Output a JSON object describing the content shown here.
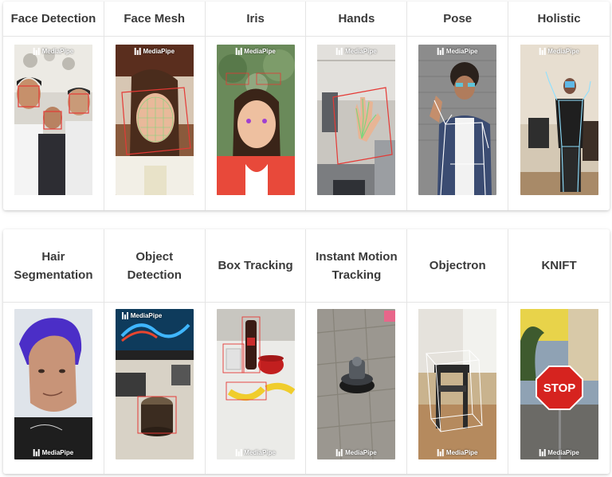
{
  "brand": "MediaPipe",
  "row1": [
    {
      "key": "face-detection",
      "title": "Face Detection",
      "logo": "top"
    },
    {
      "key": "face-mesh",
      "title": "Face Mesh",
      "logo": "top"
    },
    {
      "key": "iris",
      "title": "Iris",
      "logo": "top"
    },
    {
      "key": "hands",
      "title": "Hands",
      "logo": "top"
    },
    {
      "key": "pose",
      "title": "Pose",
      "logo": "top"
    },
    {
      "key": "holistic",
      "title": "Holistic",
      "logo": "top"
    }
  ],
  "row2": [
    {
      "key": "hair-segmentation",
      "title": "Hair Segmentation",
      "logo": "bottom"
    },
    {
      "key": "object-detection",
      "title": "Object Detection",
      "logo": "topleft"
    },
    {
      "key": "box-tracking",
      "title": "Box Tracking",
      "logo": "bottom"
    },
    {
      "key": "instant-motion-tracking",
      "title": "Instant Motion Tracking",
      "logo": "bottom"
    },
    {
      "key": "objectron",
      "title": "Objectron",
      "logo": "bottom"
    },
    {
      "key": "knift",
      "title": "KNIFT",
      "logo": "bottom"
    }
  ],
  "stop_sign_text": "STOP",
  "colors": {
    "header_text": "#3a3a3a",
    "border": "#e4e4e4",
    "annotation_red": "#e53935",
    "annotation_green": "#7cd67c",
    "annotation_white": "#ffffff"
  }
}
